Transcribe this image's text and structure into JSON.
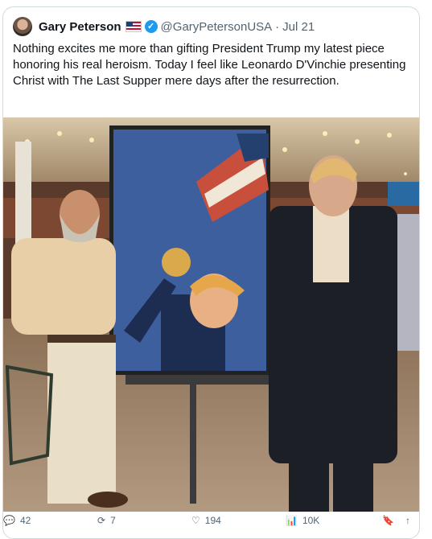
{
  "tweet": {
    "author_name": "Gary Peterson",
    "handle": "@GaryPetersonUSA",
    "separator": "·",
    "date": "Jul 21",
    "text": "Nothing excites me more than gifting President Trump my latest piece honoring his real heroism.  Today I feel like Leonardo D'Vinchie presenting Christ with The Last Supper mere days after the resurrection."
  },
  "icons": [
    "avatar",
    "us-flag-icon",
    "verified-badge-icon",
    "reply-icon",
    "retweet-icon",
    "like-icon",
    "views-icon",
    "bookmark-icon",
    "share-icon"
  ],
  "actions": {
    "replies": "42",
    "reposts": "7",
    "likes": "194",
    "views": "10K"
  },
  "colors": {
    "text_primary": "#0f1419",
    "text_secondary": "#536471",
    "verified": "#1d9bf0",
    "border": "#cfd9de"
  }
}
